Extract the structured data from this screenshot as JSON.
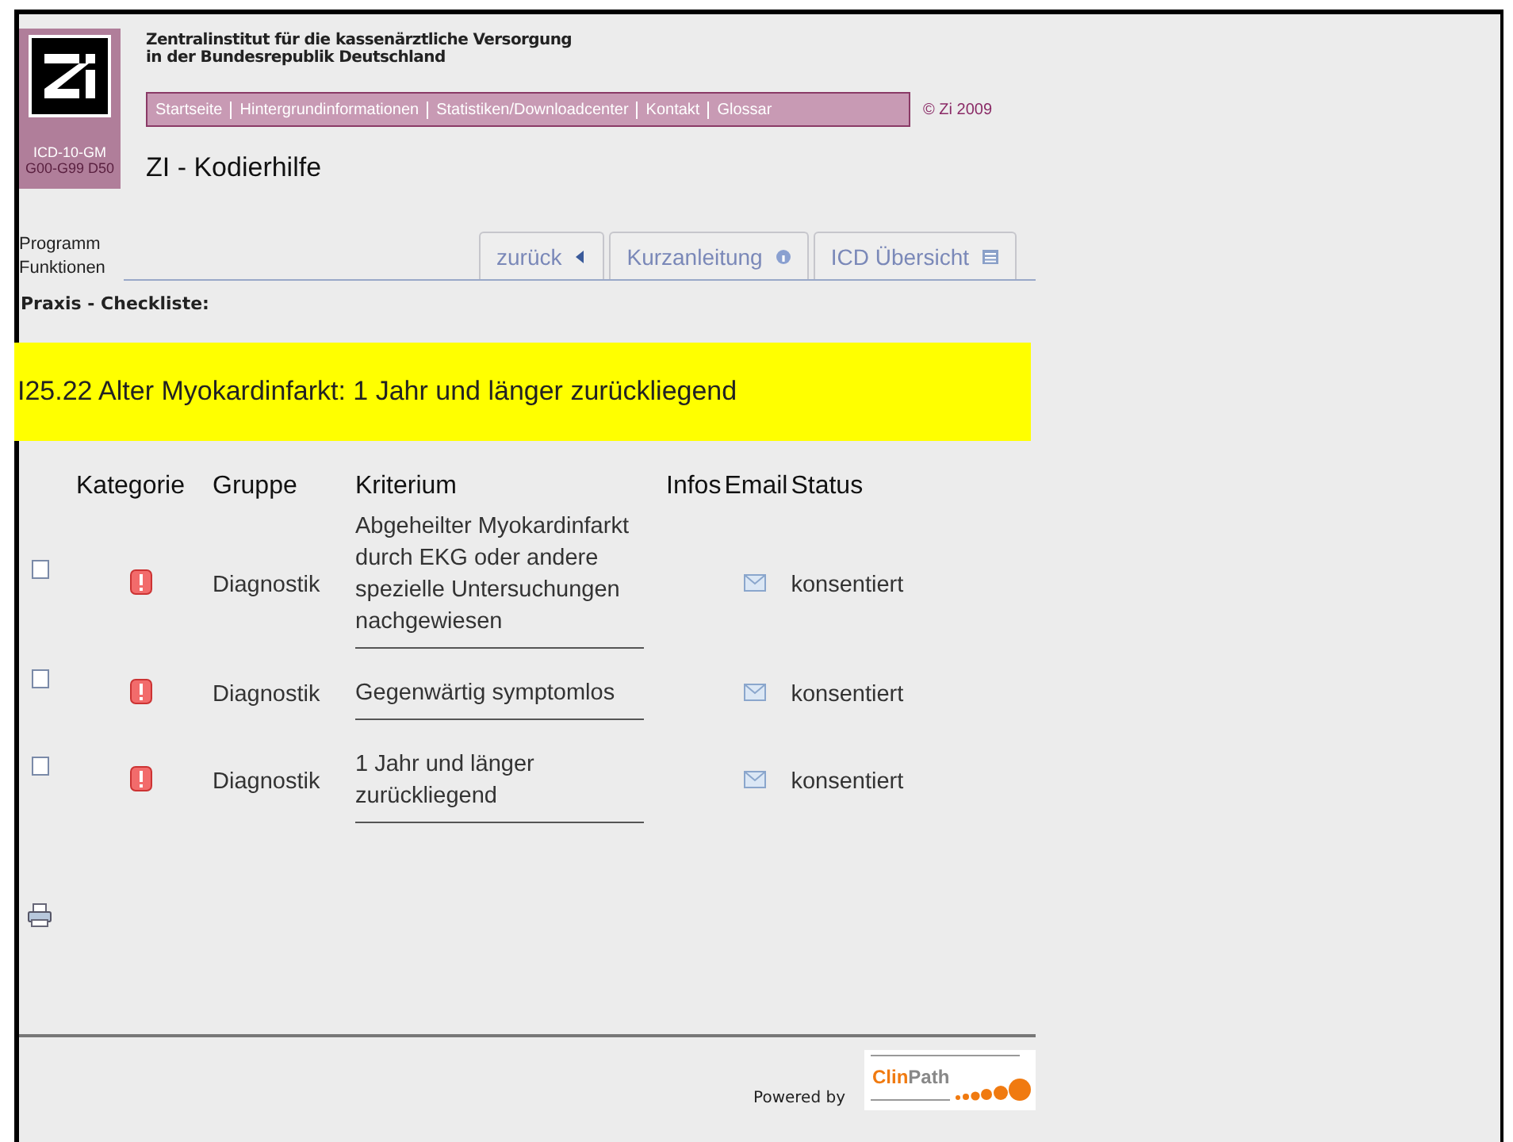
{
  "header": {
    "logo_labels": [
      "ICD-10-GM",
      "G00-G99 D50"
    ],
    "institute_lines": [
      "Zentralinstitut für die kassenärztliche Versorgung",
      "in der Bundesrepublik Deutschland"
    ],
    "nav": [
      "Startseite",
      "Hintergrundinformationen",
      "Statistiken/Downloadcenter",
      "Kontakt",
      "Glossar"
    ],
    "copyright": "© Zi 2009",
    "app_title": "ZI - Kodierhilfe"
  },
  "functions": {
    "label_lines": [
      "Programm",
      "Funktionen"
    ],
    "tabs": [
      {
        "label": "zurück",
        "kind": "back",
        "selected": false
      },
      {
        "label": "Kurzanleitung",
        "kind": "info",
        "selected": false
      },
      {
        "label": "ICD Übersicht",
        "kind": "list",
        "selected": false
      }
    ]
  },
  "section_title": "Praxis - Checkliste:",
  "diagnosis": "I25.22 Alter Myokardinfarkt: 1 Jahr und länger zurückliegend",
  "table": {
    "columns": [
      "Kategorie",
      "Gruppe",
      "Kriterium",
      "Infos",
      "Email",
      "Status"
    ],
    "rows": [
      {
        "checked": false,
        "kind": "warning",
        "group": "Diagnostik",
        "criterion": "Abgeheilter Myokardinfarkt durch EKG oder andere spezielle Untersuchungen nachgewiesen",
        "status": "konsentiert"
      },
      {
        "checked": false,
        "kind": "warning",
        "group": "Diagnostik",
        "criterion": "Gegenwärtig symptomlos",
        "status": "konsentiert"
      },
      {
        "checked": false,
        "kind": "warning",
        "group": "Diagnostik",
        "criterion": "1 Jahr und länger zurückliegend",
        "status": "konsentiert"
      }
    ]
  },
  "footer": {
    "powered_by": "Powered by",
    "logo": {
      "part1": "Clin",
      "part2": "Path"
    }
  }
}
